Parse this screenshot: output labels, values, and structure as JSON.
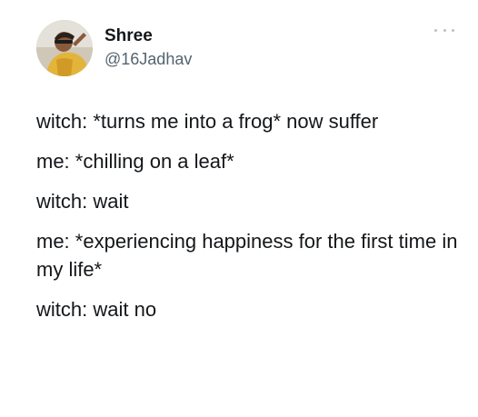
{
  "user": {
    "display_name": "Shree",
    "handle": "@16Jadhav"
  },
  "tweet": {
    "lines": [
      "witch: *turns me into a frog* now suffer",
      "me: *chilling on a leaf*",
      "witch: wait",
      "me: *experiencing happiness for the first time in my life*",
      "witch: wait no"
    ]
  },
  "icons": {
    "menu": "more-horizontal-icon",
    "avatar": "avatar"
  },
  "colors": {
    "text_primary": "#14171a",
    "text_secondary": "#536471",
    "background": "#ffffff"
  }
}
